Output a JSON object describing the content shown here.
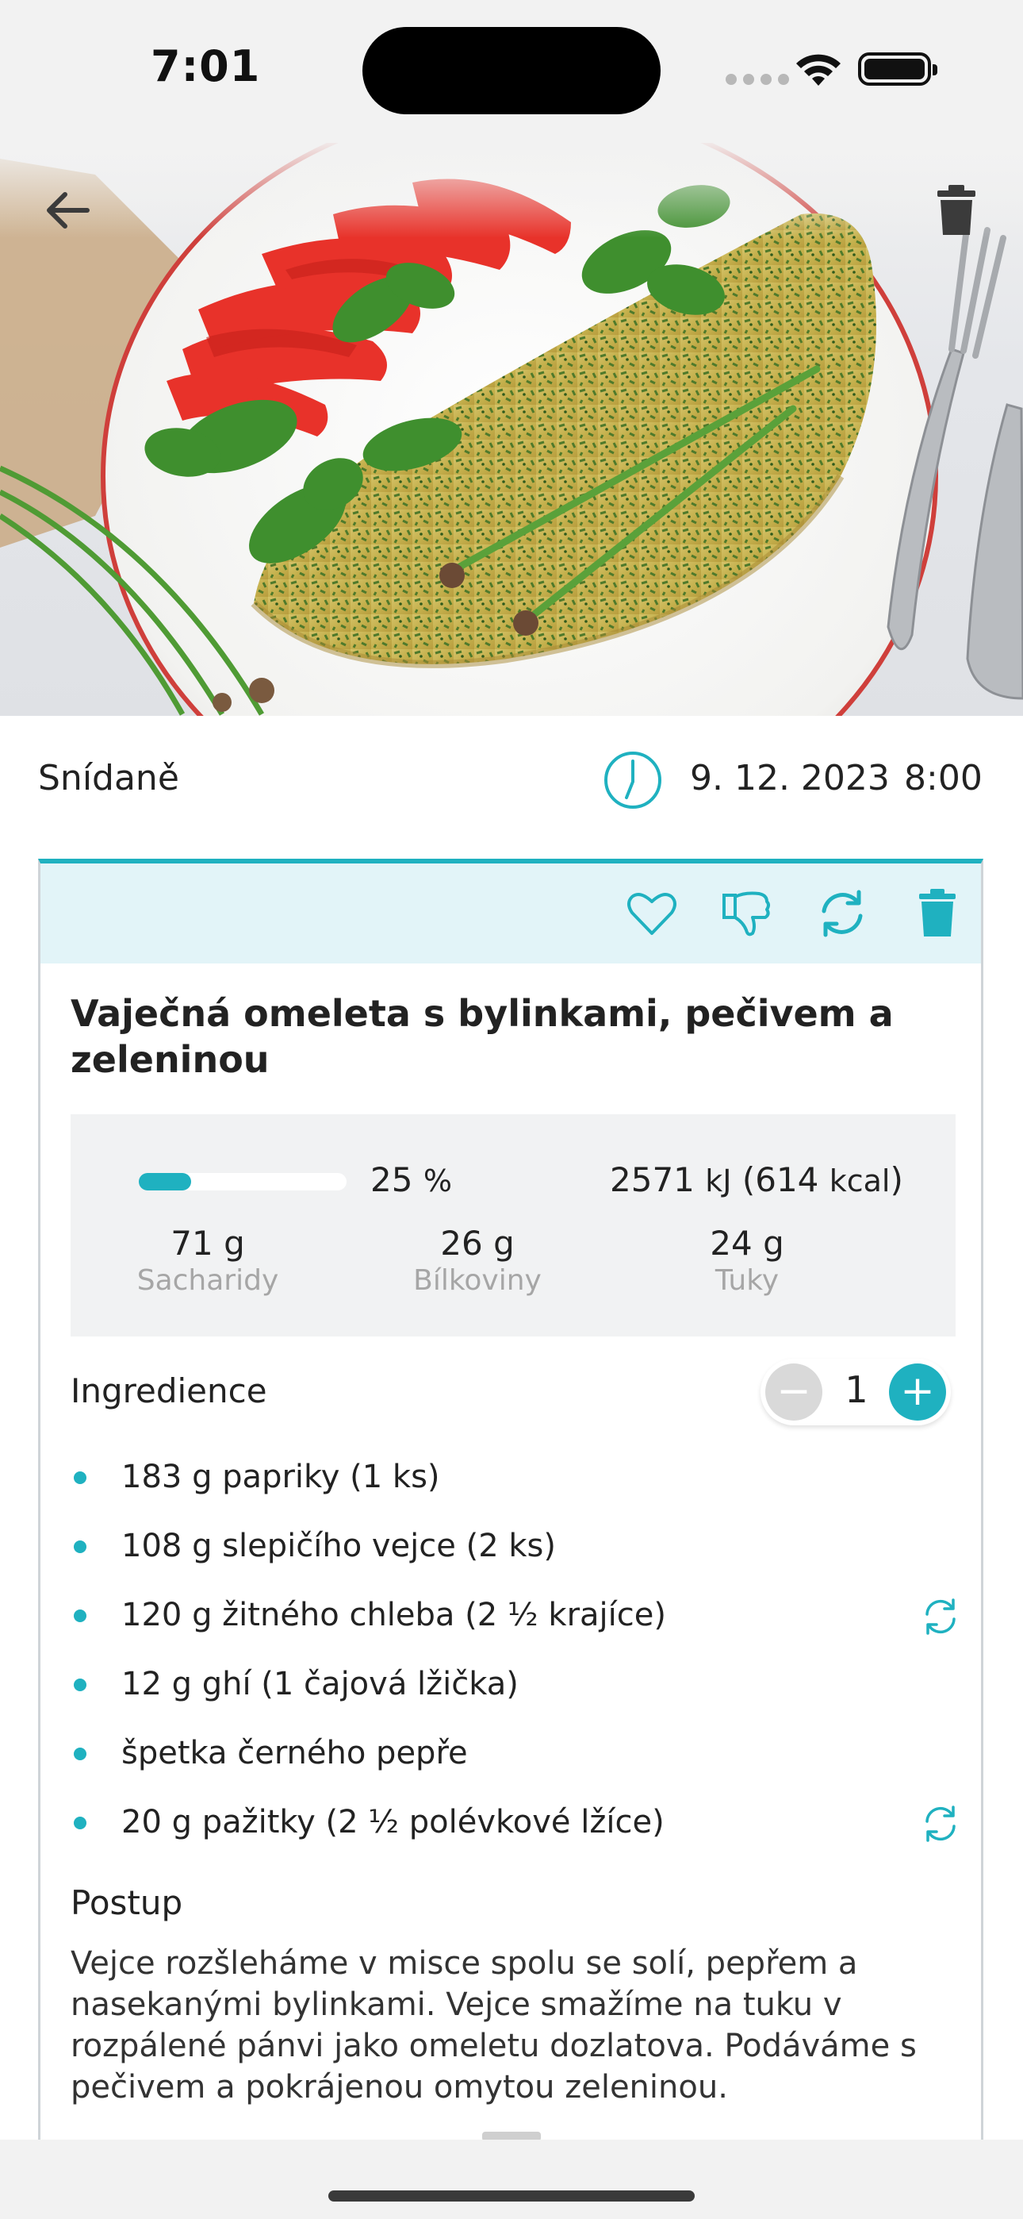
{
  "status_bar": {
    "time": "7:01"
  },
  "meal": {
    "name": "Snídaně",
    "date": "9. 12. 2023",
    "time": "8:00"
  },
  "recipe": {
    "title": "Vaječná omeleta s bylinkami, pečivem a zeleninou",
    "progress_fraction": 0.25,
    "percent_value": "25",
    "percent_unit": "%",
    "energy_kj": "2571",
    "energy_kj_unit": "kJ",
    "energy_kcal": "614",
    "energy_kcal_unit": "kcal",
    "macros": [
      {
        "value": "71",
        "unit": "g",
        "label": "Sacharidy"
      },
      {
        "value": "26",
        "unit": "g",
        "label": "Bílkoviny"
      },
      {
        "value": "24",
        "unit": "g",
        "label": "Tuky"
      }
    ]
  },
  "ingredients": {
    "heading": "Ingredience",
    "quantity": "1",
    "minus_label": "−",
    "plus_label": "+",
    "items": [
      {
        "text": "183 g papriky (1 ks)",
        "swappable": false
      },
      {
        "text": "108 g slepičího vejce (2 ks)",
        "swappable": false
      },
      {
        "text": "120 g žitného chleba (2 ½ krajíce)",
        "swappable": true
      },
      {
        "text": "12 g ghí (1 čajová lžička)",
        "swappable": false
      },
      {
        "text": "špetka černého pepře",
        "swappable": false
      },
      {
        "text": "20 g pažitky (2 ½ polévkové lžíce)",
        "swappable": true
      }
    ]
  },
  "procedure": {
    "heading": "Postup",
    "text": "Vejce rozšleháme v misce spolu se solí, pepřem a nasekanými bylinkami. Vejce smažíme na tuku v rozpálené pánvi jako omeletu dozlatova. Podáváme s pečivem a pokrájenou omytou zeleninou."
  },
  "colors": {
    "accent": "#1fb1c0",
    "toolbar_bg": "#e2f4f8",
    "nutri_bg": "#f1f2f3"
  },
  "icons": {
    "back": "arrow-left-icon",
    "hero_delete": "trash-icon",
    "clock": "clock-icon",
    "favorite": "heart-icon",
    "dislike": "thumbs-down-icon",
    "replace": "refresh-icon",
    "delete": "trash-icon",
    "ingredient_swap": "swap-icon"
  }
}
